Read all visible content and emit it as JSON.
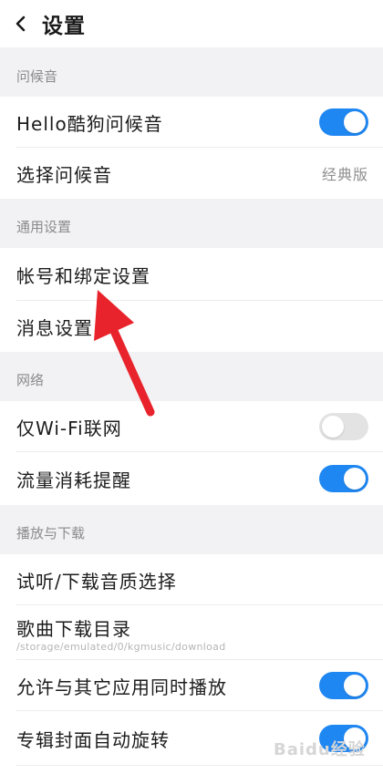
{
  "header": {
    "title": "设置"
  },
  "groups": {
    "greeting": {
      "label": "问候音",
      "rows": [
        {
          "label": "Hello酷狗问候音",
          "toggle": "on"
        },
        {
          "label": "选择问候音",
          "value": "经典版"
        }
      ]
    },
    "general": {
      "label": "通用设置",
      "rows": [
        {
          "label": "帐号和绑定设置"
        },
        {
          "label": "消息设置"
        }
      ]
    },
    "network": {
      "label": "网络",
      "rows": [
        {
          "label": "仅Wi-Fi联网",
          "toggle": "off"
        },
        {
          "label": "流量消耗提醒",
          "toggle": "on"
        }
      ]
    },
    "playback": {
      "label": "播放与下载",
      "rows": [
        {
          "label": "试听/下载音质选择"
        },
        {
          "label": "歌曲下载目录",
          "sub": "/storage/emulated/0/kgmusic/download"
        },
        {
          "label": "允许与其它应用同时播放",
          "toggle": "on"
        },
        {
          "label": "专辑封面自动旋转",
          "toggle": "on"
        }
      ]
    }
  },
  "watermark": "Baidu经验",
  "colors": {
    "accent": "#1f87f2",
    "arrow": "#e8232b"
  }
}
